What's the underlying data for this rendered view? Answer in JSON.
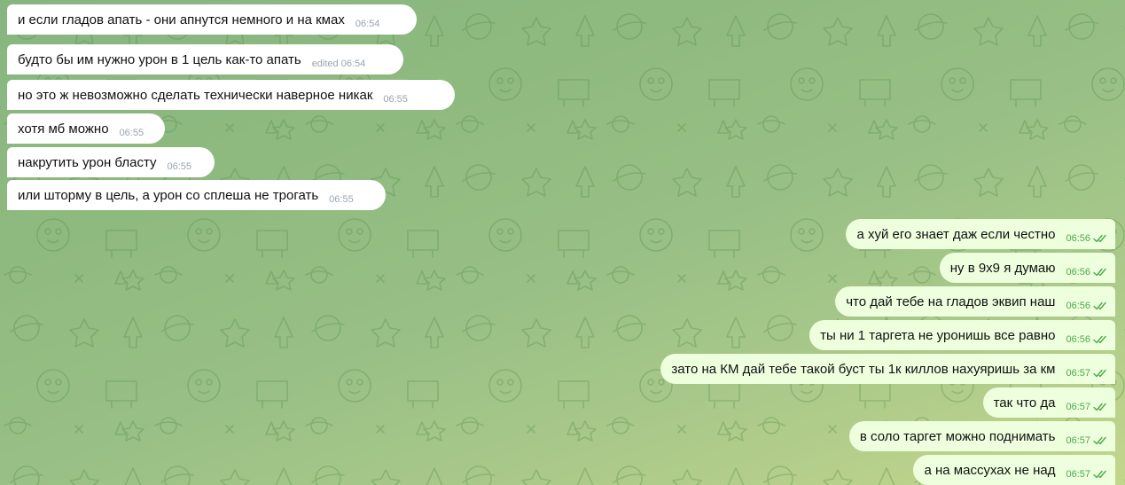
{
  "incoming": [
    {
      "text": "и если гладов апать - они апнутся немного и на кмах",
      "time": "06:54"
    },
    {
      "text": "будто бы им нужно урон в 1 цель как-то апать",
      "time": "edited 06:54"
    },
    {
      "text": "но это ж невозможно сделать технически наверное никак",
      "time": "06:55"
    },
    {
      "text": "хотя мб можно",
      "time": "06:55"
    },
    {
      "text": "накрутить урон бласту",
      "time": "06:55"
    },
    {
      "text": "или шторму в цель, а урон со сплеша не трогать",
      "time": "06:55"
    }
  ],
  "outgoing": [
    {
      "text": "а хуй его знает даж если честно",
      "time": "06:56"
    },
    {
      "text": "ну в 9х9 я думаю",
      "time": "06:56"
    },
    {
      "text": "что дай тебе на гладов эквип наш",
      "time": "06:56"
    },
    {
      "text": "ты ни 1 таргета не уронишь все равно",
      "time": "06:56"
    },
    {
      "text": "зато на КМ дай тебе такой буст ты 1к киллов нахуяришь за км",
      "time": "06:57"
    },
    {
      "text": "так что да",
      "time": "06:57"
    },
    {
      "text": "в соло таргет можно поднимать",
      "time": "06:57"
    },
    {
      "text": "а на массухах не над",
      "time": "06:57"
    }
  ],
  "colors": {
    "incoming_bubble": "#ffffff",
    "outgoing_bubble": "#eeffde",
    "outgoing_time": "#4ea84a",
    "incoming_time": "#9aa4ad"
  },
  "icons": {
    "read_status": "double-check-icon",
    "wallpaper": "doodle-pattern"
  }
}
